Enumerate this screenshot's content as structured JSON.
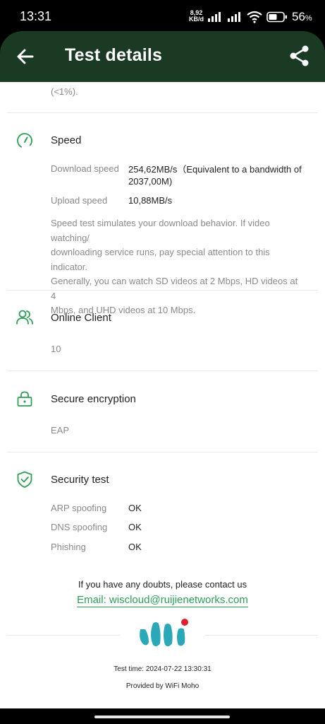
{
  "status_bar": {
    "time": "13:31",
    "net_speed_value": "8,92",
    "net_speed_unit": "KB/d",
    "battery_percent": "56",
    "battery_percent_sign": "%"
  },
  "app_bar": {
    "title": "Test details"
  },
  "top_note": "(<1%).",
  "speed": {
    "title": "Speed",
    "download_label": "Download speed",
    "download_value_line1": "254,62MB/s（Equivalent to a bandwidth of",
    "download_value_line2": "2037,00M)",
    "upload_label": "Upload speed",
    "upload_value": "10,88MB/s",
    "description_lines": [
      "Speed test simulates your download behavior. If video watching/",
      "downloading service runs, pay special attention to this indicator.",
      "Generally, you can watch SD videos at 2 Mbps, HD videos at 4",
      "Mbps, and UHD videos at 10 Mbps."
    ]
  },
  "online_client": {
    "title": "Online Client",
    "value": "10"
  },
  "secure_encryption": {
    "title": "Secure encryption",
    "value": "EAP"
  },
  "security_test": {
    "title": "Security test",
    "rows": [
      {
        "label": "ARP spoofing",
        "value": "OK"
      },
      {
        "label": "DNS spoofing",
        "value": "OK"
      },
      {
        "label": "Phishing",
        "value": "OK"
      }
    ]
  },
  "contact": {
    "text": "If you have any doubts, please contact us",
    "email": "Email: wiscloud@ruijienetworks.com"
  },
  "footer": {
    "test_time": "Test time: 2024-07-22 13:30:31",
    "provided_by": "Provided by WiFi Moho"
  },
  "colors": {
    "app_bar_bg": "#1a3a24",
    "accent_green": "#2e9e55",
    "logo_teal": "#2aa8b8",
    "logo_red": "#e0202a"
  },
  "icons": {
    "back": "arrow-left-icon",
    "share": "share-icon",
    "speed": "speedometer-icon",
    "clients": "users-icon",
    "encryption": "lock-icon",
    "security": "shield-check-icon"
  }
}
